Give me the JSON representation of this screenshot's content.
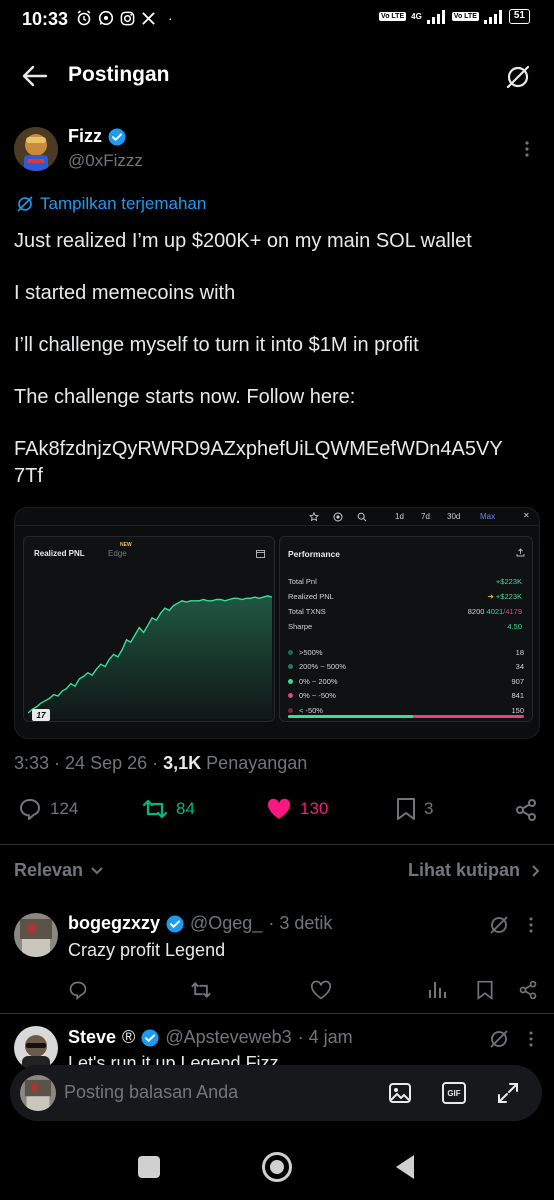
{
  "status_bar": {
    "time": "10:33",
    "network": "4G",
    "volte1": "Vo LTE",
    "volte2": "Vo LTE",
    "battery": "51"
  },
  "header": {
    "title": "Postingan"
  },
  "author": {
    "name": "Fizz",
    "handle": "@0xFizzz",
    "verified": true
  },
  "translate_label": "Tampilkan terjemahan",
  "tweet": {
    "lines": [
      "Just realized I’m up $200K+ on my main SOL wallet",
      "I started memecoins with",
      "I’ll challenge myself to turn it into $1M in profit",
      "The challenge starts now. Follow here:",
      "FAk8fzdnjzQyRWRD9AZxphefUiLQWMEefWDn4A5VY",
      "7Tf"
    ]
  },
  "media": {
    "timeframes": [
      "1d",
      "7d",
      "30d",
      "Max"
    ],
    "active_timeframe": "Max",
    "pnl_tab": "Realized PNL",
    "edge_tab": "Edge",
    "new_badge": "NEW",
    "logo": "17",
    "performance_title": "Performance",
    "stats": [
      {
        "label": "Total Pnl",
        "value": "+$223K"
      },
      {
        "label": "Realized PNL",
        "value": "+$223K"
      },
      {
        "label": "Total TXNS",
        "value": "8200",
        "value_green": "4021",
        "value_red": "4179"
      },
      {
        "label": "Sharpe",
        "value": "4.50"
      }
    ],
    "buckets": [
      {
        "label": ">500%",
        "value": "18",
        "color": "#1f6b4f"
      },
      {
        "label": "200% ~ 500%",
        "value": "34",
        "color": "#2a7a5c"
      },
      {
        "label": "0% ~ 200%",
        "value": "907",
        "color": "#3ddc97"
      },
      {
        "label": "0% ~ -50%",
        "value": "841",
        "color": "#e0457b"
      },
      {
        "label": "< -50%",
        "value": "150",
        "color": "#7a2440"
      }
    ],
    "win_fraction": 0.53,
    "curve": [
      0,
      3,
      5,
      8,
      10,
      12,
      15,
      14,
      18,
      20,
      24,
      22,
      28,
      30,
      33,
      31,
      36,
      40,
      38,
      44,
      48,
      46,
      52,
      60,
      58,
      64,
      70,
      66,
      72,
      78,
      76,
      82,
      86,
      84,
      88,
      90,
      92,
      91,
      92,
      92,
      92,
      93,
      92,
      92,
      93,
      93,
      92,
      93,
      94,
      94,
      93,
      94,
      94,
      95,
      94,
      95,
      96,
      95
    ]
  },
  "meta": {
    "time": "3:33",
    "date": "24 Sep 26",
    "views": "3,1K",
    "views_label": "Penayangan"
  },
  "actions": {
    "replies": "124",
    "reposts": "84",
    "likes": "130",
    "bookmarks": "3"
  },
  "colors": {
    "accent": "#1d9bf0",
    "repost": "#00ba7c",
    "like": "#f91880"
  },
  "sort": {
    "label": "Relevan",
    "quotes_link": "Lihat kutipan"
  },
  "replies": [
    {
      "name": "bogegzxzy",
      "handle": "@Ogeg_",
      "time": "3 detik",
      "text": "Crazy profit Legend"
    },
    {
      "name": "Steve",
      "handle": "@Apsteveweb3",
      "time": "4 jam",
      "text": "Let's run it up Legend Fizz",
      "registered": "®"
    }
  ],
  "compose": {
    "placeholder": "Posting balasan Anda",
    "gif_label": "GIF"
  }
}
